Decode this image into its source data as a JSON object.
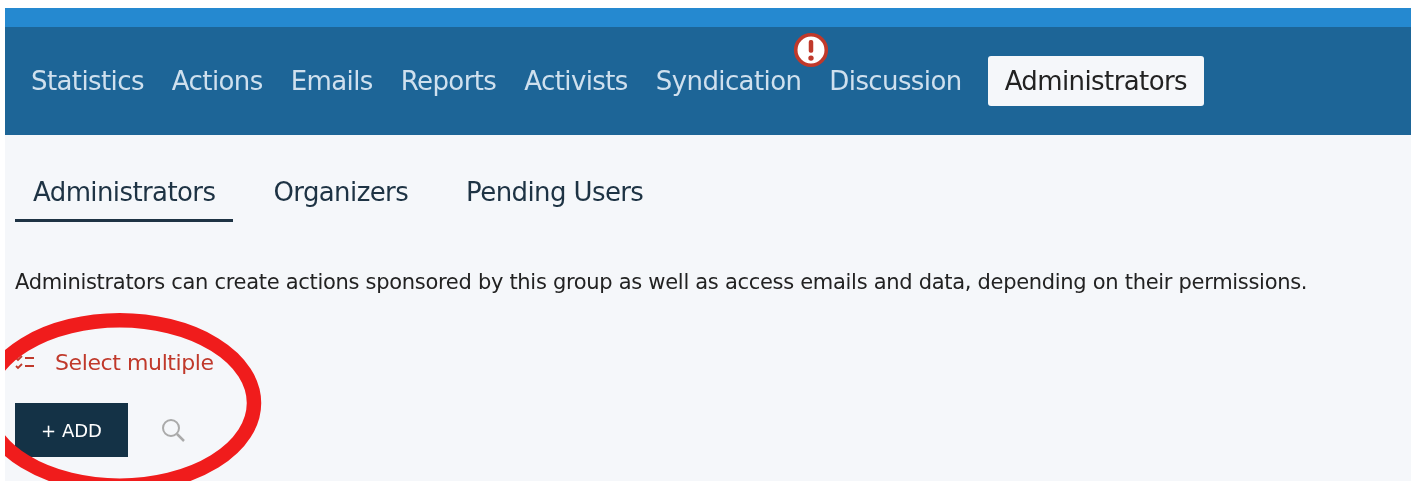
{
  "nav": [
    {
      "label": "Statistics",
      "selected": false,
      "alert": false
    },
    {
      "label": "Actions",
      "selected": false,
      "alert": false
    },
    {
      "label": "Emails",
      "selected": false,
      "alert": false
    },
    {
      "label": "Reports",
      "selected": false,
      "alert": false
    },
    {
      "label": "Activists",
      "selected": false,
      "alert": false
    },
    {
      "label": "Syndication",
      "selected": false,
      "alert": true
    },
    {
      "label": "Discussion",
      "selected": false,
      "alert": false
    },
    {
      "label": "Administrators",
      "selected": true,
      "alert": false
    }
  ],
  "subtabs": [
    {
      "label": "Administrators",
      "selected": true
    },
    {
      "label": "Organizers",
      "selected": false
    },
    {
      "label": "Pending Users",
      "selected": false
    }
  ],
  "description": "Administrators can create actions sponsored by this group as well as access emails and data, depending on their permissions.",
  "select_multiple": "Select multiple",
  "add_button": "+ ADD"
}
